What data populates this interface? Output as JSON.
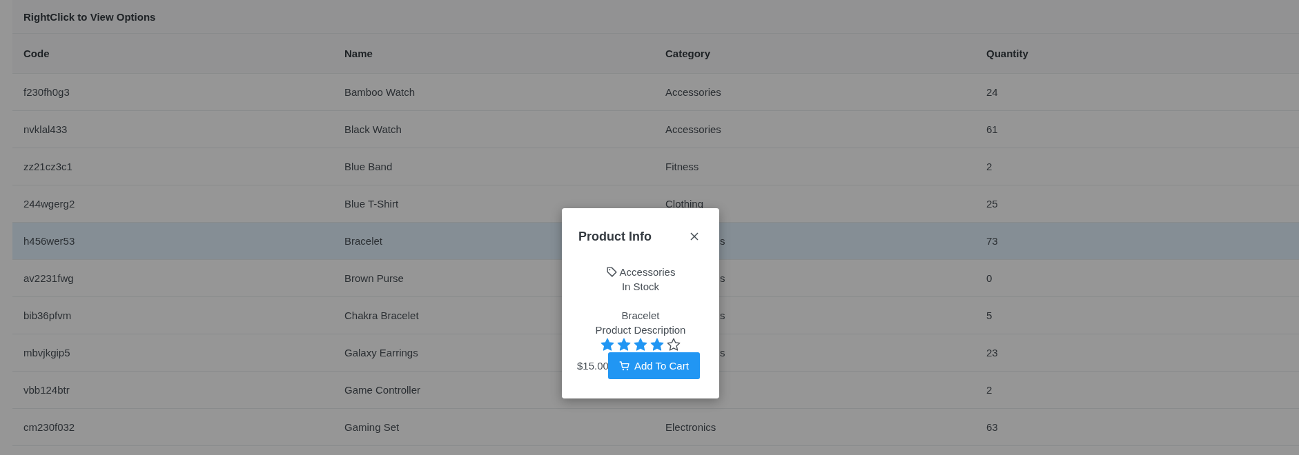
{
  "table": {
    "caption": "RightClick to View Options",
    "columns": [
      "Code",
      "Name",
      "Category",
      "Quantity"
    ],
    "rows": [
      {
        "code": "f230fh0g3",
        "name": "Bamboo Watch",
        "category": "Accessories",
        "quantity": "24",
        "selected": false
      },
      {
        "code": "nvklal433",
        "name": "Black Watch",
        "category": "Accessories",
        "quantity": "61",
        "selected": false
      },
      {
        "code": "zz21cz3c1",
        "name": "Blue Band",
        "category": "Fitness",
        "quantity": "2",
        "selected": false
      },
      {
        "code": "244wgerg2",
        "name": "Blue T-Shirt",
        "category": "Clothing",
        "quantity": "25",
        "selected": false
      },
      {
        "code": "h456wer53",
        "name": "Bracelet",
        "category": "s",
        "category_cut": true,
        "quantity": "73",
        "selected": true
      },
      {
        "code": "av2231fwg",
        "name": "Brown Purse",
        "category": "s",
        "category_cut": true,
        "quantity": "0",
        "selected": false
      },
      {
        "code": "bib36pfvm",
        "name": "Chakra Bracelet",
        "category": "s",
        "category_cut": true,
        "quantity": "5",
        "selected": false
      },
      {
        "code": "mbvjkgip5",
        "name": "Galaxy Earrings",
        "category": "s",
        "category_cut": true,
        "quantity": "23",
        "selected": false
      },
      {
        "code": "vbb124btr",
        "name": "Game Controller",
        "quantity": "2",
        "selected": false
      },
      {
        "code": "cm230f032",
        "name": "Gaming Set",
        "category": "Electronics",
        "quantity": "63",
        "selected": false
      }
    ]
  },
  "dialog": {
    "title": "Product Info",
    "category": "Accessories",
    "status": "In Stock",
    "product": "Bracelet",
    "description": "Product Description",
    "stars": 4,
    "price": "$15.00",
    "button": "Add To Cart"
  }
}
